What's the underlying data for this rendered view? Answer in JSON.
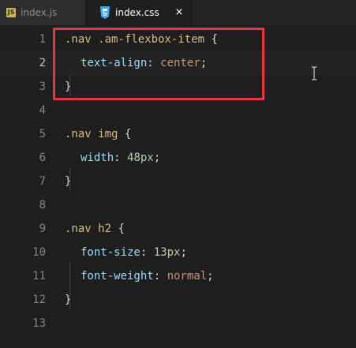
{
  "tabs": [
    {
      "label": "index.js",
      "icon": "javascript-file-icon",
      "active": false
    },
    {
      "label": "index.css",
      "icon": "css-file-icon",
      "active": true
    }
  ],
  "tab_close_glyph": "×",
  "colors": {
    "background": "#1e1e1e",
    "highlight_box": "#e3363e",
    "selector": "#d7ba7d",
    "property": "#9cdcfe",
    "value": "#ce9178",
    "number": "#b5cea8"
  },
  "editor": {
    "active_line": 2,
    "lines": [
      {
        "number": "1",
        "tokens": [
          ".nav .am-flexbox-item",
          " {"
        ]
      },
      {
        "number": "2",
        "tokens": [
          "text-align",
          ": ",
          "center",
          ";"
        ]
      },
      {
        "number": "3",
        "tokens": [
          "}"
        ]
      },
      {
        "number": "4",
        "tokens": []
      },
      {
        "number": "5",
        "tokens": [
          ".nav img",
          " {"
        ]
      },
      {
        "number": "6",
        "tokens": [
          "width",
          ": ",
          "48px",
          ";"
        ]
      },
      {
        "number": "7",
        "tokens": [
          "}"
        ]
      },
      {
        "number": "8",
        "tokens": []
      },
      {
        "number": "9",
        "tokens": [
          ".nav h2",
          " {"
        ]
      },
      {
        "number": "10",
        "tokens": [
          "font-size",
          ": ",
          "13px",
          ";"
        ]
      },
      {
        "number": "11",
        "tokens": [
          "font-weight",
          ": ",
          "normal",
          ";"
        ]
      },
      {
        "number": "12",
        "tokens": [
          "}"
        ]
      },
      {
        "number": "13",
        "tokens": []
      }
    ]
  }
}
